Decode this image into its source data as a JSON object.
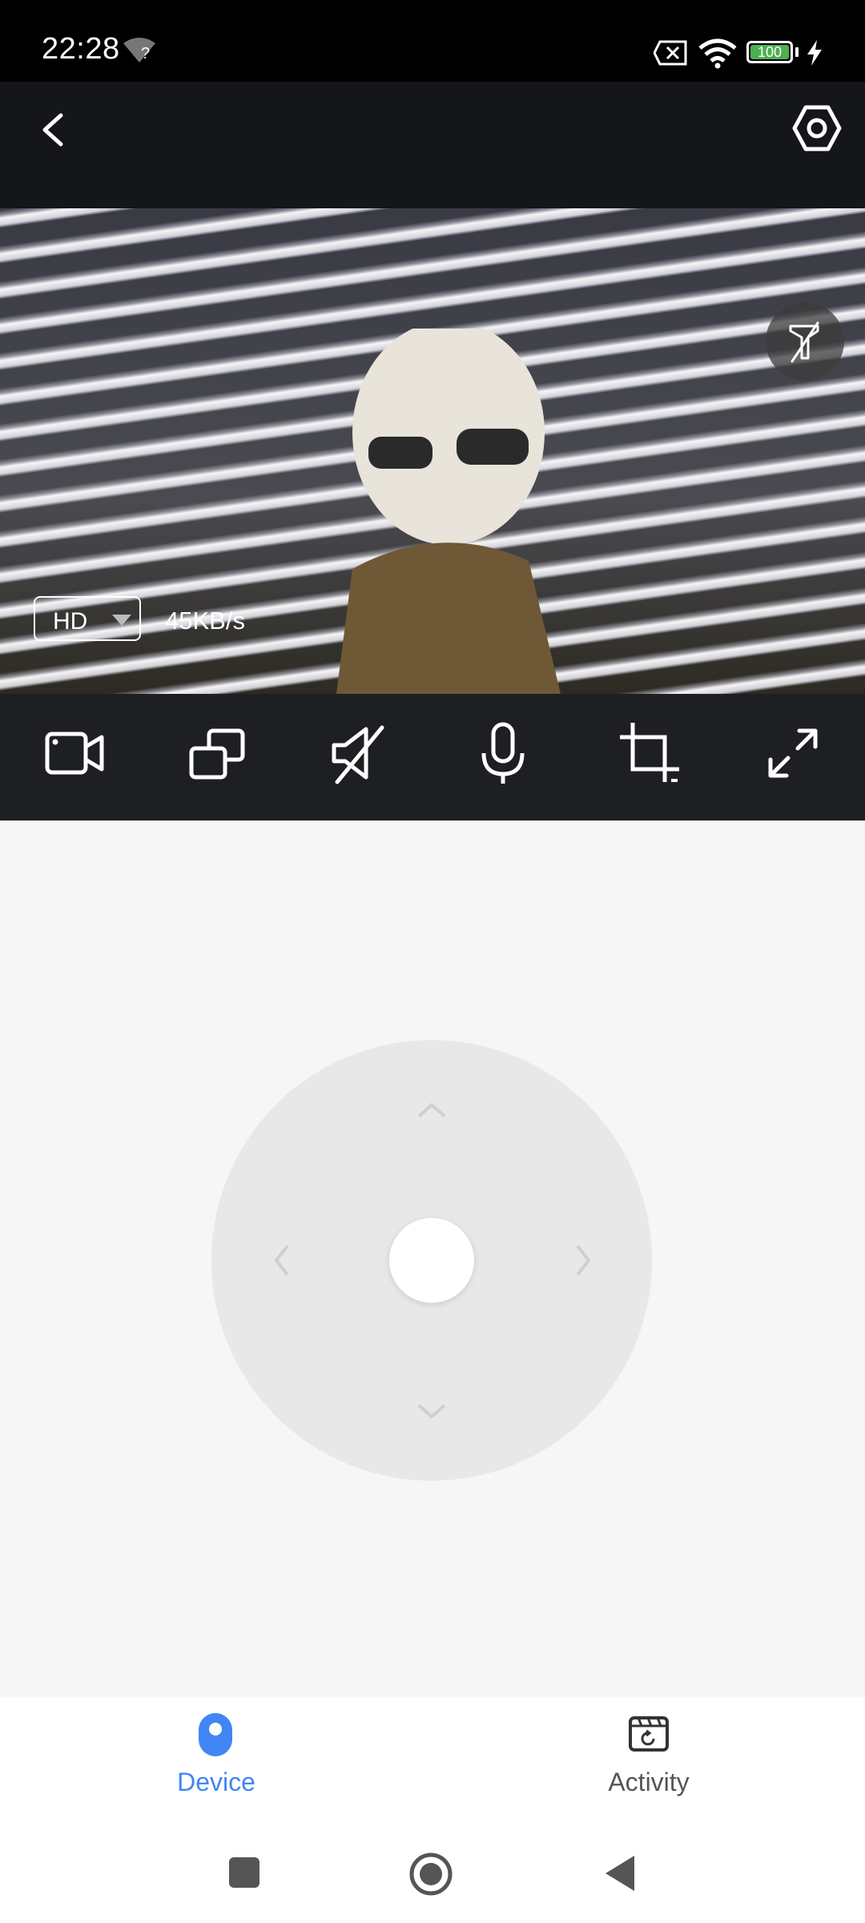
{
  "status_bar": {
    "time": "22:28",
    "wifi_hint": "?",
    "battery": "100"
  },
  "video": {
    "quality": "HD",
    "bitrate": "45KB/s"
  },
  "toolbar": {
    "icons": [
      "record-video-icon",
      "multi-screen-icon",
      "mute-icon",
      "microphone-icon",
      "crop-icon",
      "fullscreen-icon"
    ]
  },
  "bottom_nav": {
    "device_label": "Device",
    "activity_label": "Activity",
    "active_color": "#4285f4",
    "inactive_color": "#555555"
  }
}
